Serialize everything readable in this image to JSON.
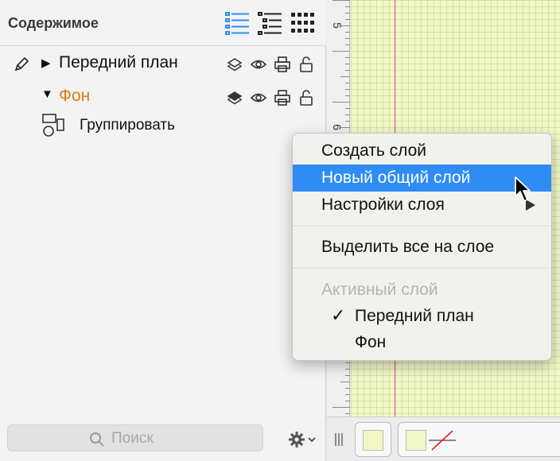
{
  "sidebar": {
    "title": "Содержимое",
    "view_buttons": [
      {
        "name": "list-view",
        "icon": "list-icon",
        "color": "#2f8cf4"
      },
      {
        "name": "outline-view",
        "icon": "outline-icon",
        "color": "#222222"
      },
      {
        "name": "grid-view",
        "icon": "grid-icon",
        "color": "#222222"
      }
    ],
    "layers": [
      {
        "label": "Передний план",
        "expanded": false,
        "active": true,
        "color": "#111111"
      },
      {
        "label": "Фон",
        "expanded": true,
        "active": false,
        "color": "#e07b14"
      }
    ],
    "child_items": [
      {
        "label": "Группировать",
        "icon": "group-shapes-icon"
      }
    ],
    "row_icons": [
      "layers-icon",
      "eye-icon",
      "printer-icon",
      "lock-icon"
    ],
    "search": {
      "placeholder": "Поиск"
    },
    "gear_icon": "gear-icon"
  },
  "canvas": {
    "background": "#f2f7c7",
    "ruler_labels": [
      "5",
      "6"
    ]
  },
  "context_menu": {
    "items": [
      {
        "label": "Создать слой",
        "state": "normal"
      },
      {
        "label": "Новый общий слой",
        "state": "highlighted"
      },
      {
        "label": "Настройки слоя",
        "state": "normal",
        "submenu": true
      }
    ],
    "items2": [
      {
        "label": "Выделить все на слое",
        "state": "normal"
      }
    ],
    "section_header": "Активный слой",
    "active_layer_options": [
      {
        "label": "Передний план",
        "checked": true
      },
      {
        "label": "Фон",
        "checked": false
      }
    ],
    "check_glyph": "✓",
    "highlight_color": "#2f8cf4"
  }
}
